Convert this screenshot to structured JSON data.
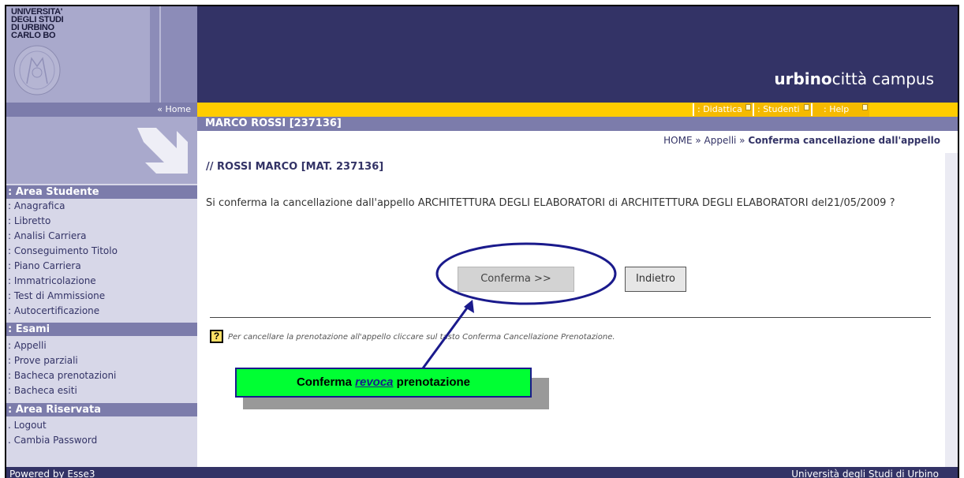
{
  "header": {
    "logo_lines": [
      "UNIVERSITA'",
      "DEGLI STUDI",
      "DI URBINO",
      "CARLO BO"
    ],
    "brand_bold": "urbino",
    "brand_light": "città campus"
  },
  "nav": {
    "home_label": "« Home",
    "tabs": [
      {
        "label": ": Didattica"
      },
      {
        "label": ": Studenti"
      },
      {
        "label": ": Help"
      }
    ]
  },
  "user_bar": "MARCO ROSSI [237136]",
  "breadcrumb": {
    "home": "HOME",
    "sep": " » ",
    "appelli": "Appelli",
    "current": "Conferma cancellazione dall'appello"
  },
  "student_title": "// ROSSI MARCO [MAT. 237136]",
  "message": "Si conferma la cancellazione dall'appello ARCHITETTURA DEGLI ELABORATORI di ARCHITETTURA DEGLI ELABORATORI del21/05/2009 ?",
  "buttons": {
    "confirm": "Conferma >>",
    "back": "Indietro"
  },
  "help": {
    "icon": "?",
    "text": "Per cancellare la prenotazione all'appello cliccare sul tasto Conferma Cancellazione Prenotazione."
  },
  "annotation": {
    "pre": "Conferma ",
    "em": "revoca",
    "post": " prenotazione"
  },
  "sidebar": {
    "sections": [
      {
        "title": ": Area Studente",
        "items": [
          ": Anagrafica",
          ": Libretto",
          ": Analisi Carriera",
          ": Conseguimento Titolo",
          ": Piano Carriera",
          ": Immatricolazione",
          ": Test di Ammissione",
          ": Autocertificazione"
        ]
      },
      {
        "title": ": Esami",
        "items": [
          ": Appelli",
          ": Prove parziali",
          ": Bacheca prenotazioni",
          ": Bacheca esiti"
        ]
      },
      {
        "title": ": Area Riservata",
        "items": [
          ". Logout",
          ". Cambia Password"
        ]
      }
    ]
  },
  "footer": {
    "left": "Powered by Esse3",
    "right": "Università degli Studi di Urbino"
  },
  "colors": {
    "header": "#333366",
    "nav_yellow": "#ffcc00",
    "sidebar": "#d7d7e8",
    "accent": "#7c7cab",
    "annotation_green": "#00ff33"
  }
}
